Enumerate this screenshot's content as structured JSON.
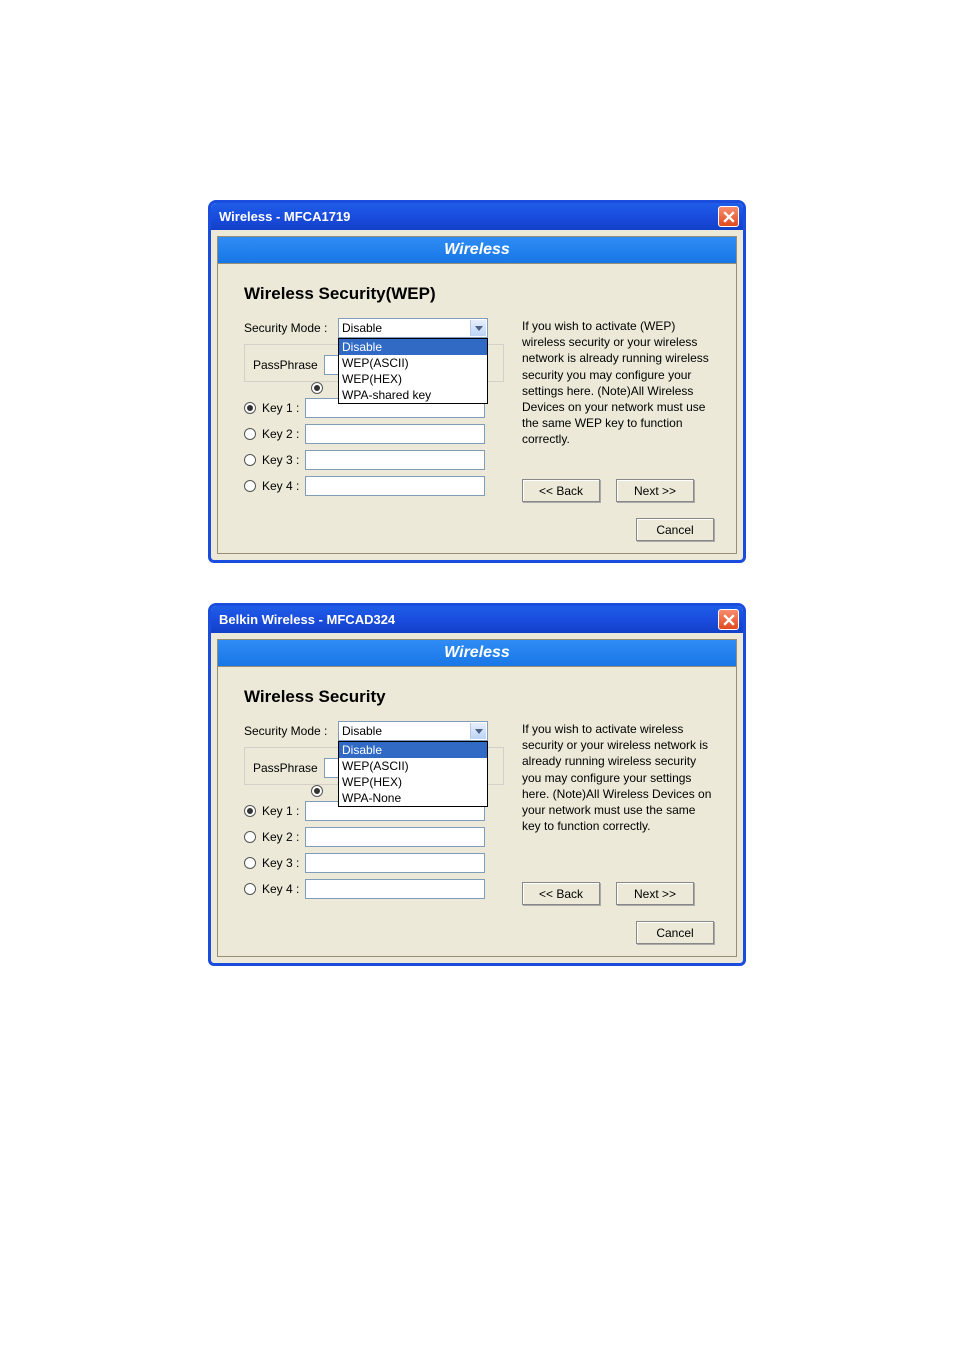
{
  "dialogs": [
    {
      "title": "Wireless - MFCA1719",
      "banner": "Wireless",
      "section_title": "Wireless Security(WEP)",
      "security_mode_label": "Security Mode :",
      "security_mode_value": "Disable",
      "dropdown_options": [
        "Disable",
        "WEP(ASCII)",
        "WEP(HEX)",
        "WPA-shared key"
      ],
      "passphrase_label": "PassPhrase",
      "passphrase_value": "",
      "keys": [
        {
          "label": "Key 1 :",
          "value": "",
          "selected": true
        },
        {
          "label": "Key 2 :",
          "value": "",
          "selected": false
        },
        {
          "label": "Key 3 :",
          "value": "",
          "selected": false
        },
        {
          "label": "Key 4 :",
          "value": "",
          "selected": false
        }
      ],
      "help_text": "If you wish to activate (WEP) wireless security or your wireless network is already running wireless security you may configure your settings here. (Note)All Wireless Devices on your network must use the same WEP key to function correctly.",
      "back_label": "<< Back",
      "next_label": "Next >>",
      "cancel_label": "Cancel"
    },
    {
      "title": "Belkin Wireless - MFCAD324",
      "banner": "Wireless",
      "section_title": "Wireless Security",
      "security_mode_label": "Security Mode :",
      "security_mode_value": "Disable",
      "dropdown_options": [
        "Disable",
        "WEP(ASCII)",
        "WEP(HEX)",
        "WPA-None"
      ],
      "passphrase_label": "PassPhrase",
      "passphrase_value": "",
      "keys": [
        {
          "label": "Key 1 :",
          "value": "",
          "selected": true
        },
        {
          "label": "Key 2 :",
          "value": "",
          "selected": false
        },
        {
          "label": "Key 3 :",
          "value": "",
          "selected": false
        },
        {
          "label": "Key 4 :",
          "value": "",
          "selected": false
        }
      ],
      "help_text": "If you wish to activate wireless security or your wireless network is already running wireless security you may configure your settings here. (Note)All Wireless Devices on your network must use the same key to function correctly.",
      "back_label": "<< Back",
      "next_label": "Next >>",
      "cancel_label": "Cancel"
    }
  ]
}
